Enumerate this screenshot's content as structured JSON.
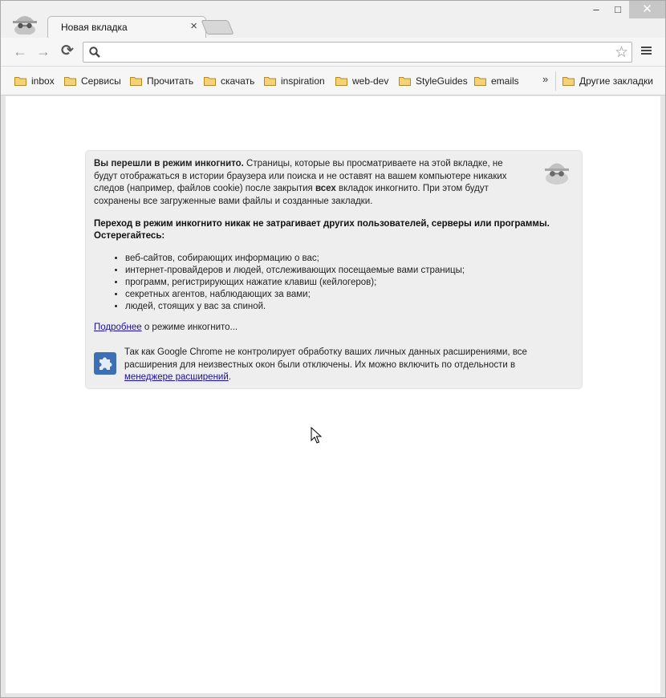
{
  "tab": {
    "title": "Новая вкладка",
    "close": "×"
  },
  "window_controls": {
    "minimize": "–",
    "maximize": "□",
    "close": "✕"
  },
  "nav": {
    "back": "←",
    "forward": "→",
    "reload": "⟳"
  },
  "omnibox": {
    "value": "",
    "placeholder": ""
  },
  "bookmarks": [
    {
      "label": "inbox"
    },
    {
      "label": "Сервисы"
    },
    {
      "label": "Прочитать"
    },
    {
      "label": "скачать"
    },
    {
      "label": "inspiration"
    },
    {
      "label": "web-dev"
    },
    {
      "label": "StyleGuides"
    },
    {
      "label": "emails"
    }
  ],
  "bookmarks_overflow": "»",
  "other_bookmarks": "Другие закладки",
  "incognito": {
    "intro_bold": "Вы перешли в режим инкогнито.",
    "intro_rest1": " Страницы, которые вы просматриваете на этой вкладке, не будут отображаться в истории браузера или поиска и не оставят на вашем компьютере никаких следов (например, файлов cookie) после закрытия ",
    "intro_all": "всех",
    "intro_rest2": " вкладок инкогнито. При этом будут сохранены все загруженные вами файлы и созданные закладки.",
    "warning": "Переход в режим инкогнито никак не затрагивает других пользователей, серверы или программы. Остерегайтесь:",
    "list": [
      "веб-сайтов, собирающих информацию о вас;",
      "интернет-провайдеров и людей, отслеживающих посещаемые вами страницы;",
      "программ, регистрирующих нажатие клавиш (кейлогеров);",
      "секретных агентов, наблюдающих за вами;",
      "людей, стоящих у вас за спиной."
    ],
    "more_link": "Подробнее",
    "more_rest": " о режиме инкогнито...",
    "ext_text": "Так как Google Chrome не контролирует обработку ваших личных данных расширениями, все расширения для неизвестных окон были отключены. Их можно включить по отдельности в ",
    "ext_link": "менеджере расширений",
    "ext_end": "."
  },
  "colors": {
    "link": "#1a0dab",
    "folder": "#e8c25a",
    "panel_bg": "#eeeeee"
  }
}
